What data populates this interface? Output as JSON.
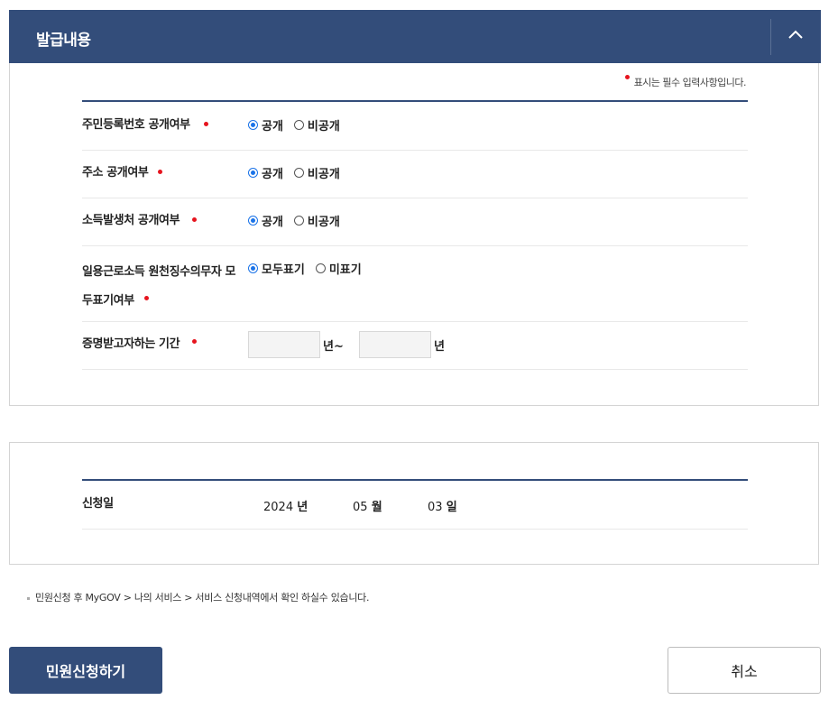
{
  "section": {
    "title": "발급내용"
  },
  "required_note": "표시는 필수 입력사항입니다.",
  "fields": [
    {
      "label": "주민등록번호 공개여부",
      "options": [
        "공개",
        "비공개"
      ],
      "selected": 0
    },
    {
      "label": "주소 공개여부",
      "options": [
        "공개",
        "비공개"
      ],
      "selected": 0
    },
    {
      "label": "소득발생처 공개여부",
      "options": [
        "공개",
        "비공개"
      ],
      "selected": 0
    },
    {
      "label_line1": "일용근로소득 원천징수의무자 모",
      "label_line2": "두표기여부",
      "options": [
        "모두표기",
        "미표기"
      ],
      "selected": 0
    }
  ],
  "period": {
    "label": "증명받고자하는 기간",
    "from_value": "",
    "to_value": "",
    "from_unit": "년~",
    "to_unit": "년"
  },
  "application_date": {
    "label": "신청일",
    "year": "2024",
    "year_unit": "년",
    "month": "05",
    "month_unit": "월",
    "day": "03",
    "day_unit": "일"
  },
  "notice": "민원신청 후 MyGOV > 나의 서비스 > 서비스 신청내역에서 확인 하실수 있습니다.",
  "buttons": {
    "submit": "민원신청하기",
    "cancel": "취소"
  },
  "colors": {
    "primary": "#334d7a",
    "required": "#e6141e",
    "radio_checked": "#1a73e8"
  }
}
